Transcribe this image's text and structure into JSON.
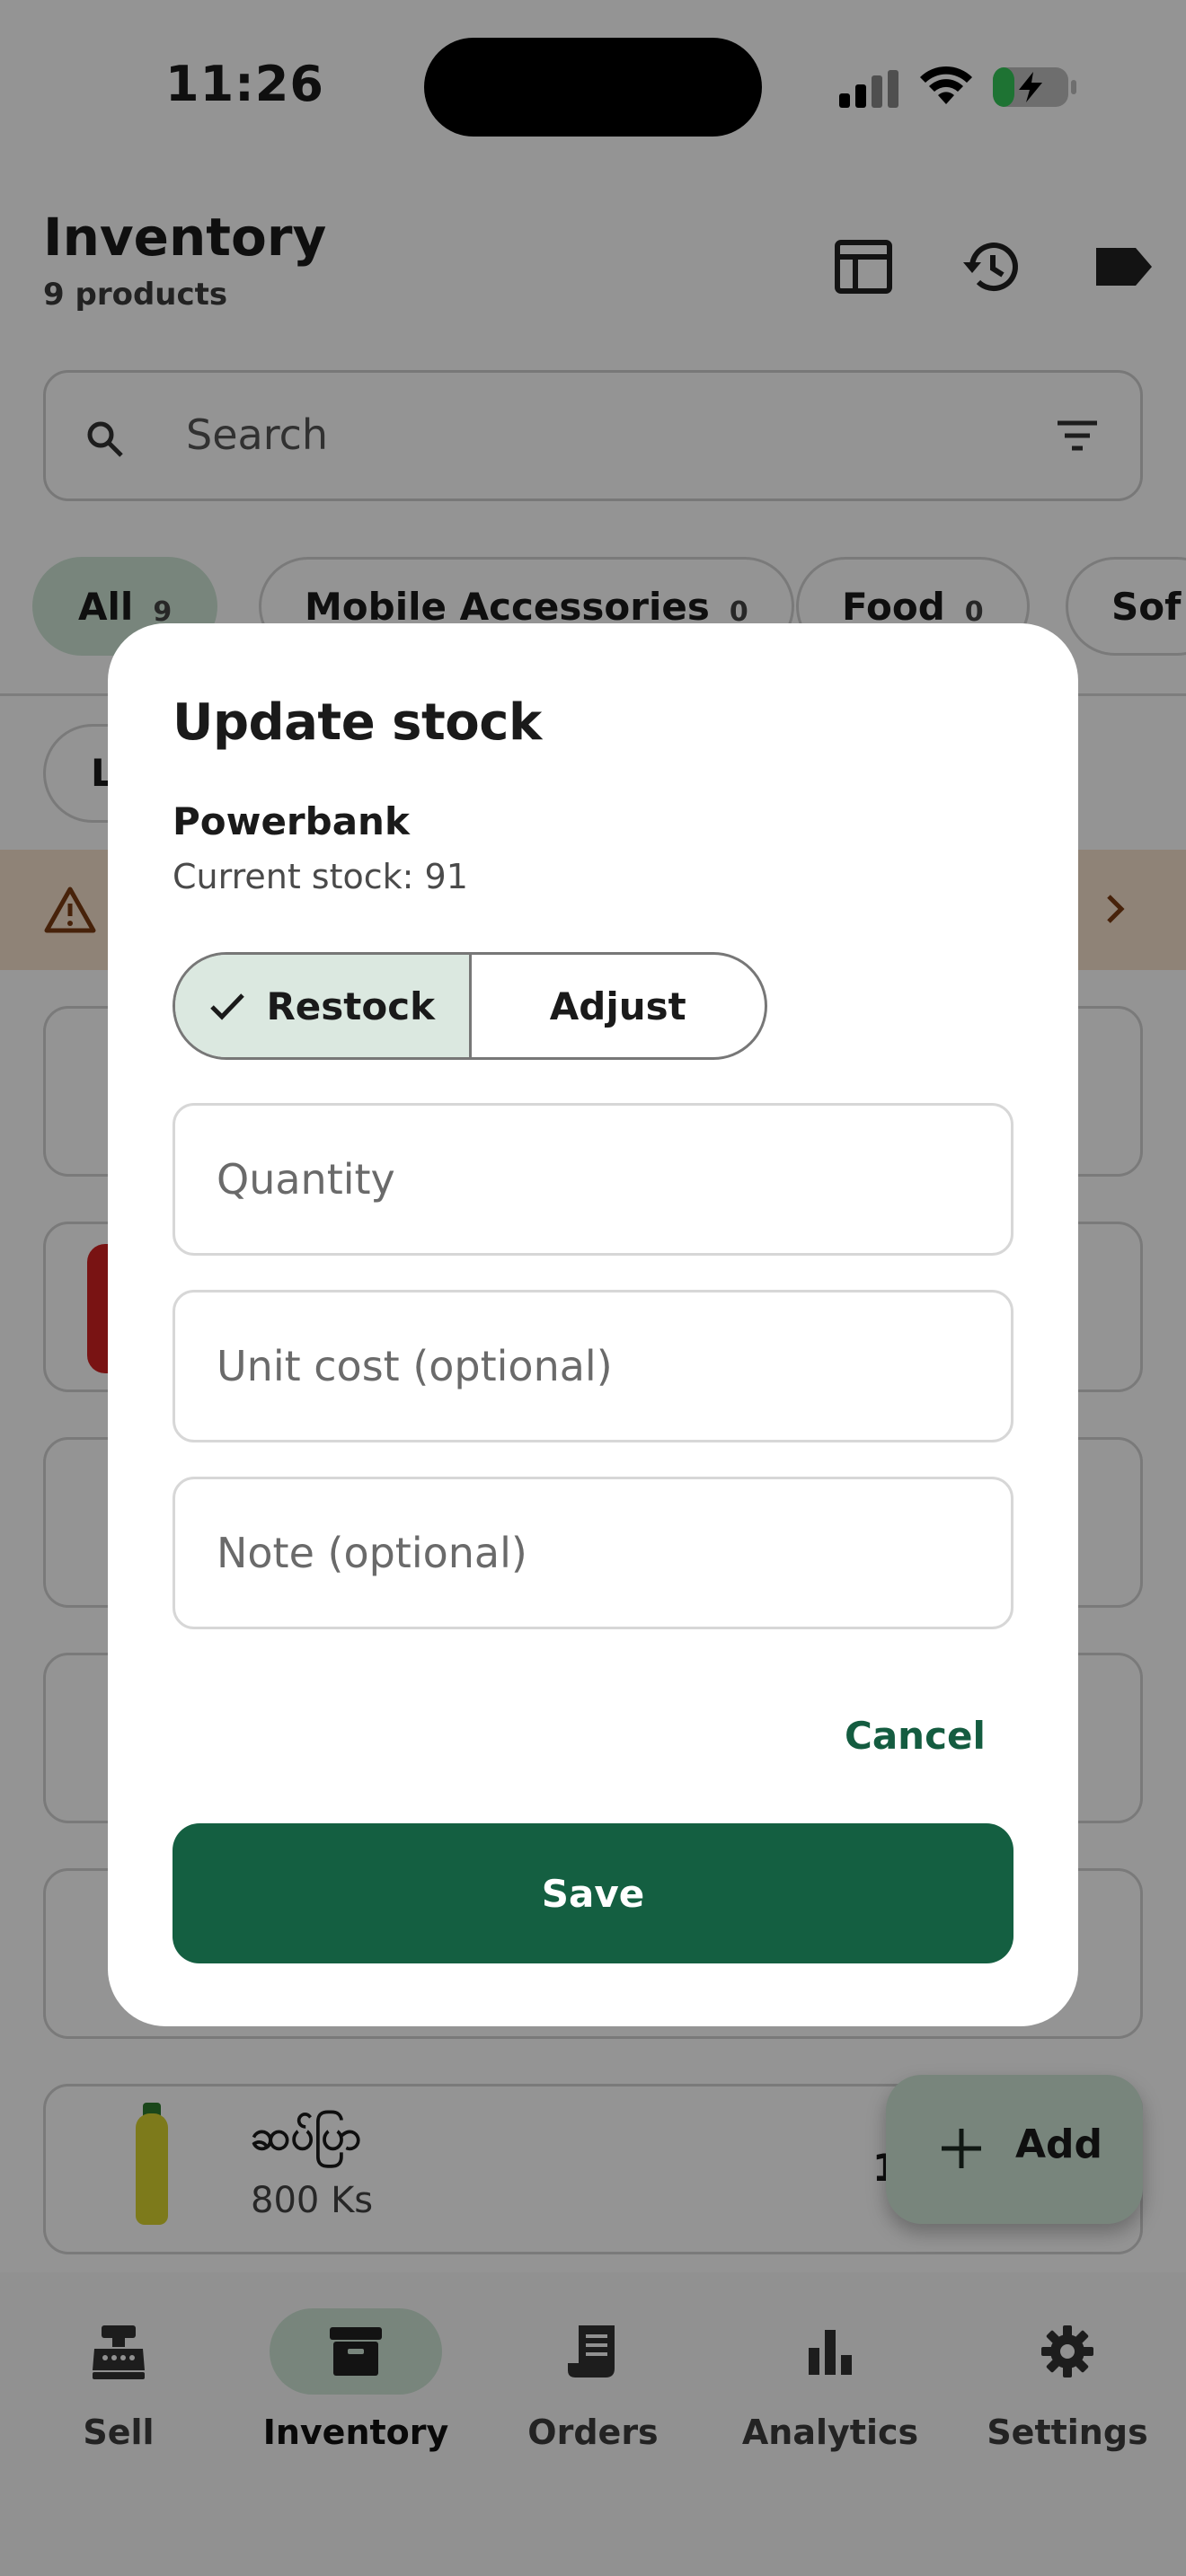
{
  "status_bar": {
    "time": "11:26"
  },
  "header": {
    "title": "Inventory",
    "subtitle": "9 products",
    "icons": [
      "table-icon",
      "history-icon",
      "label-tag-icon"
    ]
  },
  "search": {
    "placeholder": "Search"
  },
  "category_chips": [
    {
      "label": "All",
      "count": "9",
      "active": true
    },
    {
      "label": "Mobile Accessories",
      "count": "0",
      "active": false
    },
    {
      "label": "Food",
      "count": "0",
      "active": false
    },
    {
      "label": "Sof",
      "count": "",
      "active": false
    }
  ],
  "sub_chip": {
    "label": "L"
  },
  "list_items": [
    {
      "name": "ဆပ်ပြာ",
      "price": "800 Ks",
      "qty": "1"
    }
  ],
  "fab": {
    "label": "Add"
  },
  "nav": [
    {
      "label": "Sell",
      "icon": "cash-register-icon"
    },
    {
      "label": "Inventory",
      "icon": "archive-box-icon",
      "active": true
    },
    {
      "label": "Orders",
      "icon": "receipt-icon"
    },
    {
      "label": "Analytics",
      "icon": "bar-chart-icon"
    },
    {
      "label": "Settings",
      "icon": "gear-icon"
    }
  ],
  "dialog": {
    "title": "Update stock",
    "product_name": "Powerbank",
    "current_stock": "Current stock: 91",
    "mode_options": [
      "Restock",
      "Adjust"
    ],
    "selected_mode": "Restock",
    "quantity_placeholder": "Quantity",
    "unit_cost_placeholder": "Unit cost (optional)",
    "note_placeholder": "Note (optional)",
    "cancel_label": "Cancel",
    "save_label": "Save"
  },
  "colors": {
    "primary": "#145f41",
    "chip_active": "#cfe6d6",
    "warning_banner": "#f6e2cd",
    "segment_selected": "#dbe8e0"
  }
}
